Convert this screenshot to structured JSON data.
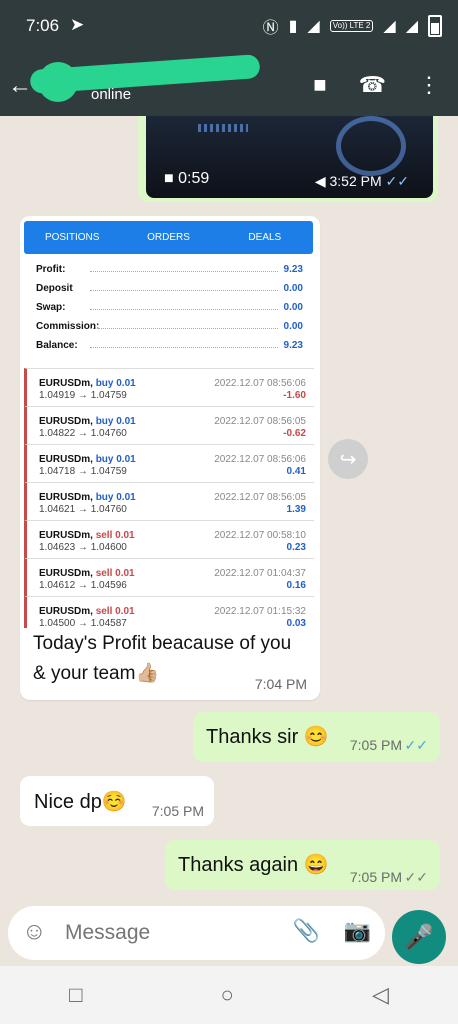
{
  "status_bar": {
    "time": "7:06",
    "network_badge": "Vo)) LTE 2"
  },
  "header": {
    "status": "online"
  },
  "video": {
    "duration": "0:59",
    "time": "3:52 PM"
  },
  "trading_screenshot": {
    "tabs": [
      "POSITIONS",
      "ORDERS",
      "DEALS"
    ],
    "summary": [
      {
        "label": "Profit:",
        "value": "9.23"
      },
      {
        "label": "Deposit",
        "value": "0.00"
      },
      {
        "label": "Swap:",
        "value": "0.00"
      },
      {
        "label": "Commission:",
        "value": "0.00"
      },
      {
        "label": "Balance:",
        "value": "9.23"
      }
    ],
    "trades": [
      {
        "pair": "EURUSDm,",
        "type": "buy 0.01",
        "prices": "1.04919 → 1.04759",
        "date": "2022.12.07 08:56:06",
        "profit": "-1.60"
      },
      {
        "pair": "EURUSDm,",
        "type": "buy 0.01",
        "prices": "1.04822 → 1.04760",
        "date": "2022.12.07 08:56:05",
        "profit": "-0.62"
      },
      {
        "pair": "EURUSDm,",
        "type": "buy 0.01",
        "prices": "1.04718 → 1.04759",
        "date": "2022.12.07 08:56:06",
        "profit": "0.41"
      },
      {
        "pair": "EURUSDm,",
        "type": "buy 0.01",
        "prices": "1.04621 → 1.04760",
        "date": "2022.12.07 08:56:05",
        "profit": "1.39"
      },
      {
        "pair": "EURUSDm,",
        "type": "sell 0.01",
        "prices": "1.04623 → 1.04600",
        "date": "2022.12.07 00:58:10",
        "profit": "0.23"
      },
      {
        "pair": "EURUSDm,",
        "type": "sell 0.01",
        "prices": "1.04612 → 1.04596",
        "date": "2022.12.07 01:04:37",
        "profit": "0.16"
      },
      {
        "pair": "EURUSDm,",
        "type": "sell 0.01",
        "prices": "1.04500 → 1.04587",
        "date": "2022.12.07 01:15:32",
        "profit": "0.03"
      }
    ]
  },
  "caption": {
    "text": "Today's Profit beacause of you & your team",
    "emoji": "👍🏼",
    "time": "7:04 PM"
  },
  "messages": [
    {
      "direction": "out",
      "text": "Thanks sir",
      "emoji": "😊",
      "time": "7:05 PM"
    },
    {
      "direction": "in",
      "text": "Nice dp",
      "emoji": "☺️",
      "time": "7:05 PM"
    },
    {
      "direction": "out",
      "text": "Thanks again",
      "emoji": "😄",
      "time": "7:05 PM"
    }
  ],
  "composer": {
    "placeholder": "Message"
  },
  "colors": {
    "appbar": "#2f3b3c",
    "outgoing": "#dcf8c6",
    "accent": "#1c7ee6",
    "mic": "#128c7e"
  }
}
